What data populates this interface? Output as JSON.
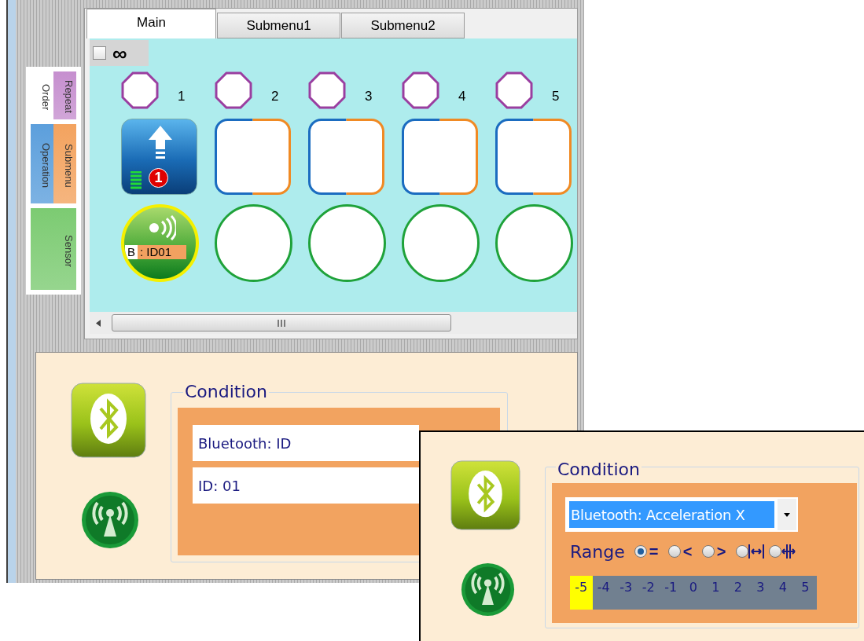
{
  "palette": [
    [
      {
        "label": "Order",
        "color": "#ffffff"
      },
      {
        "label": "Repeat",
        "color": "#c68fcf"
      }
    ],
    [
      {
        "label": "Operation",
        "color": "#5c9fdc"
      },
      {
        "label": "Submenu",
        "color": "#f3a35f"
      }
    ],
    [
      {
        "label": "Sensor",
        "color": "#7ccb72"
      }
    ]
  ],
  "tabs": [
    {
      "label": "Main",
      "selected": true
    },
    {
      "label": "Submenu1",
      "selected": false
    },
    {
      "label": "Submenu2",
      "selected": false
    }
  ],
  "loop": {
    "checked": false,
    "label": "∞"
  },
  "slots": [
    {
      "number": "1",
      "operation": {
        "kind": "up",
        "badge": "1"
      },
      "sensor": {
        "kind": "bluetooth",
        "letter": "B",
        "label": ": ID01"
      }
    },
    {
      "number": "2"
    },
    {
      "number": "3"
    },
    {
      "number": "4"
    },
    {
      "number": "5"
    }
  ],
  "condition_panel": {
    "title": "Condition",
    "fields": [
      {
        "value": "Bluetooth: ID"
      },
      {
        "value": "ID: 01"
      }
    ]
  },
  "inset": {
    "title": "Condition",
    "dropdown": {
      "value": "Bluetooth: Acceleration X",
      "highlighted": true
    },
    "range_label": "Range",
    "range_options": [
      {
        "kind": "text",
        "label": "=",
        "selected": true
      },
      {
        "kind": "text",
        "label": "<",
        "selected": false
      },
      {
        "kind": "text",
        "label": ">",
        "selected": false
      },
      {
        "kind": "inside",
        "selected": false
      },
      {
        "kind": "outside",
        "selected": false
      }
    ],
    "scale": [
      {
        "label": "-5",
        "selected": true
      },
      {
        "label": "-4",
        "selected": false
      },
      {
        "label": "-3",
        "selected": false
      },
      {
        "label": "-2",
        "selected": false
      },
      {
        "label": "-1",
        "selected": false
      },
      {
        "label": "0",
        "selected": false
      },
      {
        "label": "1",
        "selected": false
      },
      {
        "label": "2",
        "selected": false
      },
      {
        "label": "3",
        "selected": false
      },
      {
        "label": "4",
        "selected": false
      },
      {
        "label": "5",
        "selected": false
      }
    ]
  }
}
